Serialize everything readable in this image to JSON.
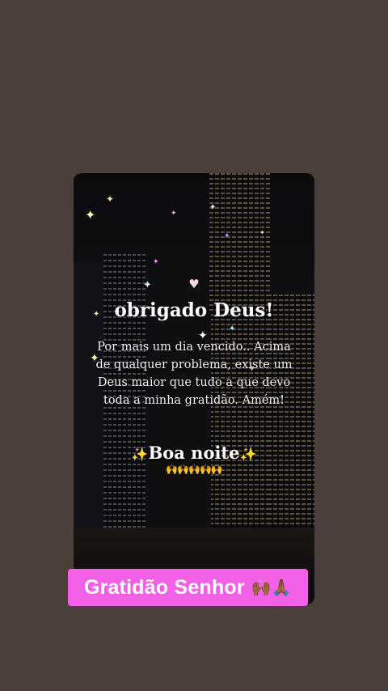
{
  "post": {
    "heart_icon": "heart-icon",
    "title": "obrigado Deus!",
    "message": "Por mais um dia vencido.. Acima de qualquer problema, existe um Deus maior que tudo a que devo toda a minha gratidão. Amém!",
    "greeting": "Boa noite",
    "sparkle_left": "✨",
    "sparkle_right": "✨",
    "hands": "🙌🙌🙌🙌🙌"
  },
  "banner": {
    "text": "Gratidão Senhor",
    "emoji": "🙌🏾🙏🏾"
  },
  "colors": {
    "background": "#4b4039",
    "banner": "#f260e6",
    "text": "#ffffff",
    "sparkle": "#ffd76a"
  }
}
